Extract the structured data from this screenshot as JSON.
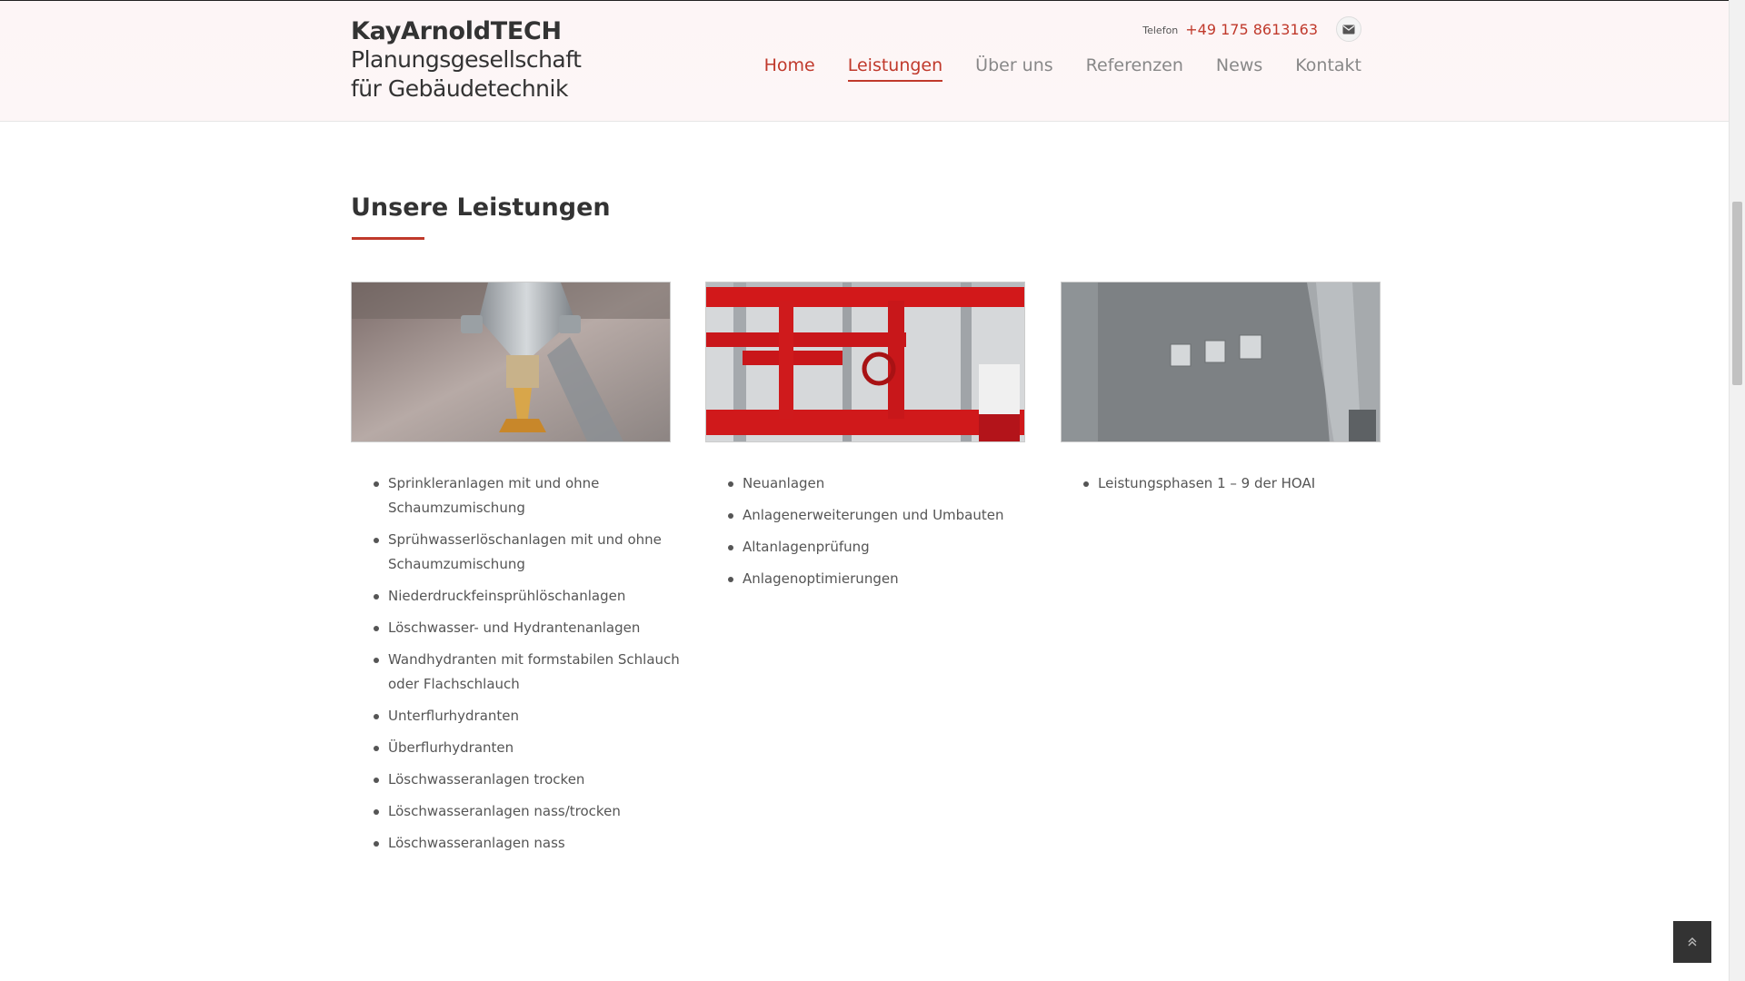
{
  "brand": {
    "name": "KayArnoldTECH",
    "tagline_line1": "Planungsgesellschaft",
    "tagline_line2": "für Gebäudetechnik"
  },
  "contact": {
    "label": "Telefon",
    "phone": "+49 175 8613163",
    "mail_icon": "envelope-icon"
  },
  "nav": {
    "items": [
      {
        "label": "Home"
      },
      {
        "label": "Leistungen"
      },
      {
        "label": "Über uns"
      },
      {
        "label": "Referenzen"
      },
      {
        "label": "News"
      },
      {
        "label": "Kontakt"
      }
    ],
    "active": "Leistungen"
  },
  "section": {
    "title": "Unsere Leistungen"
  },
  "columns": [
    {
      "image": "sprinkler-head-photo",
      "items": [
        "Sprinkleranlagen mit und ohne Schaumzumischung",
        "Sprühwasserlöschanlagen mit und ohne Schaumzumischung",
        "Niederdruckfeinsprühlöschanlagen",
        "Löschwasser- und Hydrantenanlagen",
        "Wandhydranten mit formstabilen Schlauch oder Flachschlauch",
        "Unterflurhydranten",
        "Überflurhydranten",
        "Löschwasseranlagen trocken",
        "Löschwasseranlagen nass/trocken",
        "Löschwasseranlagen nass"
      ]
    },
    {
      "image": "red-pipes-photo",
      "items": [
        "Neuanlagen",
        "Anlagenerweiterungen und Umbauten",
        "Altanlagenprüfung",
        "Anlagenoptimierungen"
      ]
    },
    {
      "image": "building-facade-photo",
      "items": [
        "Leistungsphasen 1 – 9 der HOAI"
      ]
    }
  ],
  "colors": {
    "accent": "#c0392b",
    "text": "#333333",
    "nav_inactive": "#888888"
  },
  "back_to_top_icon": "double-chevron-up-icon"
}
